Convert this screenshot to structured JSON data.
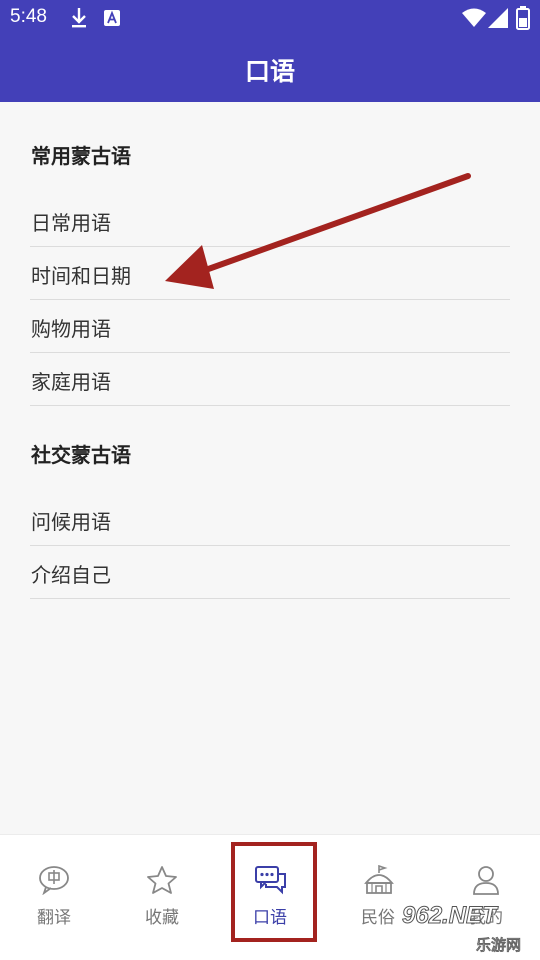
{
  "status_bar": {
    "time": "5:48",
    "icons": [
      "download-icon",
      "a-badge-icon",
      "wifi-icon",
      "signal-icon",
      "battery-icon"
    ]
  },
  "app_bar": {
    "title": "口语"
  },
  "sections": [
    {
      "title": "常用蒙古语",
      "items": [
        "日常用语",
        "时间和日期",
        "购物用语",
        "家庭用语"
      ]
    },
    {
      "title": "社交蒙古语",
      "items": [
        "问候用语",
        "介绍自己"
      ]
    }
  ],
  "bottom_nav": {
    "items": [
      {
        "label": "翻译",
        "icon": "translate-bubble-icon"
      },
      {
        "label": "收藏",
        "icon": "star-icon"
      },
      {
        "label": "口语",
        "icon": "chat-bubbles-icon",
        "active": true
      },
      {
        "label": "民俗",
        "icon": "yurt-icon"
      },
      {
        "label": "我的",
        "icon": "person-icon"
      }
    ]
  },
  "watermark": {
    "top": "962.NET",
    "bottom": "乐游网"
  },
  "colors": {
    "primary": "#4340b8",
    "annotation": "#a3231f",
    "active_nav": "#3b3fa8"
  }
}
